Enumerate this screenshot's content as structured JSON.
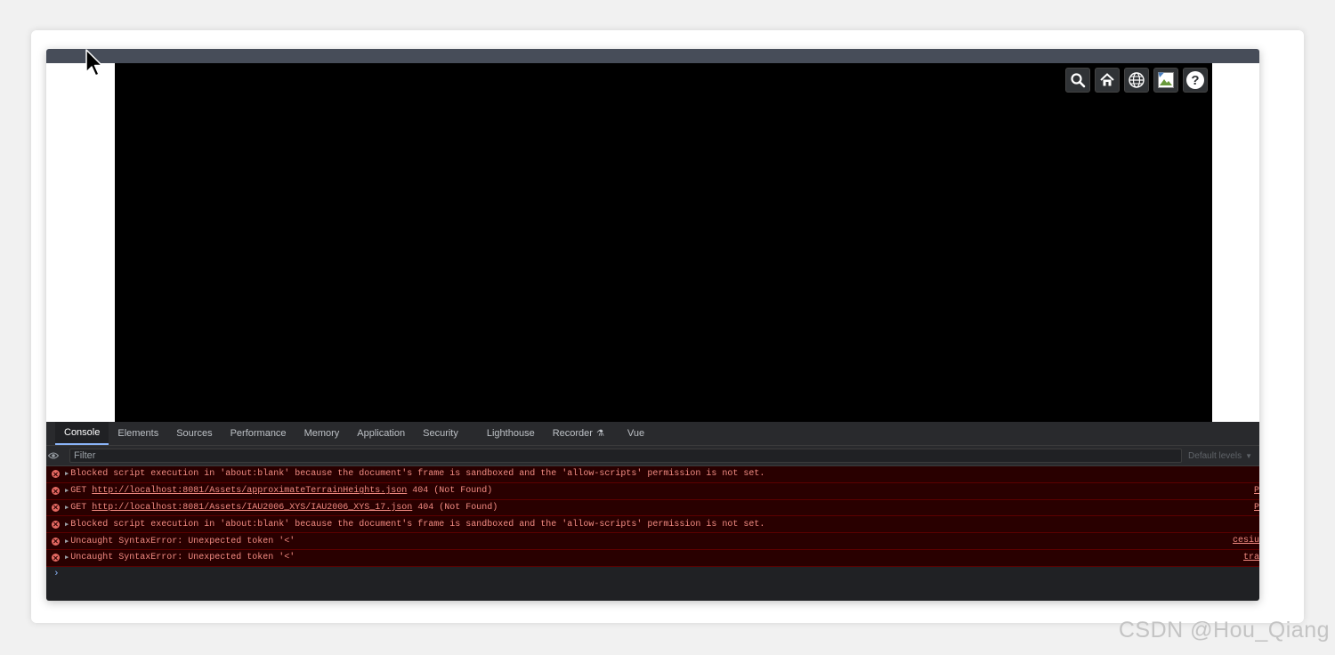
{
  "toolbar": {
    "buttons": [
      {
        "icon": "search-icon"
      },
      {
        "icon": "home-icon"
      },
      {
        "icon": "globe-icon"
      },
      {
        "icon": "broken-image-icon"
      },
      {
        "icon": "help-icon"
      }
    ]
  },
  "devtools": {
    "tabs": [
      "Console",
      "Elements",
      "Sources",
      "Performance",
      "Memory",
      "Application",
      "Security",
      "Lighthouse",
      "Recorder",
      "Vue"
    ],
    "recorder_flask": "⚗",
    "filter": {
      "placeholder": "Filter",
      "value": ""
    },
    "levels": {
      "label": "Default levels",
      "caret": "▼"
    },
    "messages": [
      {
        "pre": "Blocked script execution in 'about:blank' because the document's frame is sandboxed and the 'allow-scripts' permission is not set.",
        "link": "",
        "post": "",
        "source": ""
      },
      {
        "pre": "GET ",
        "link": "http://localhost:8081/Assets/approximateTerrainHeights.json",
        "post": " 404 (Not Found)",
        "source": "P"
      },
      {
        "pre": "GET ",
        "link": "http://localhost:8081/Assets/IAU2006_XYS/IAU2006_XYS_17.json",
        "post": " 404 (Not Found)",
        "source": "P"
      },
      {
        "pre": "Blocked script execution in 'about:blank' because the document's frame is sandboxed and the 'allow-scripts' permission is not set.",
        "link": "",
        "post": "",
        "source": ""
      },
      {
        "pre": "Uncaught SyntaxError: Unexpected token '<'",
        "link": "",
        "post": "",
        "source": "cesiu"
      },
      {
        "pre": "Uncaught SyntaxError: Unexpected token '<'",
        "link": "",
        "post": "",
        "source": "tra"
      }
    ],
    "prompt": "›"
  },
  "watermark": "CSDN @Hou_Qiang",
  "colors": {
    "error_bg": "#290000",
    "error_text": "#f28b82",
    "devtools_bg": "#202124",
    "titlebar": "#474d59"
  }
}
